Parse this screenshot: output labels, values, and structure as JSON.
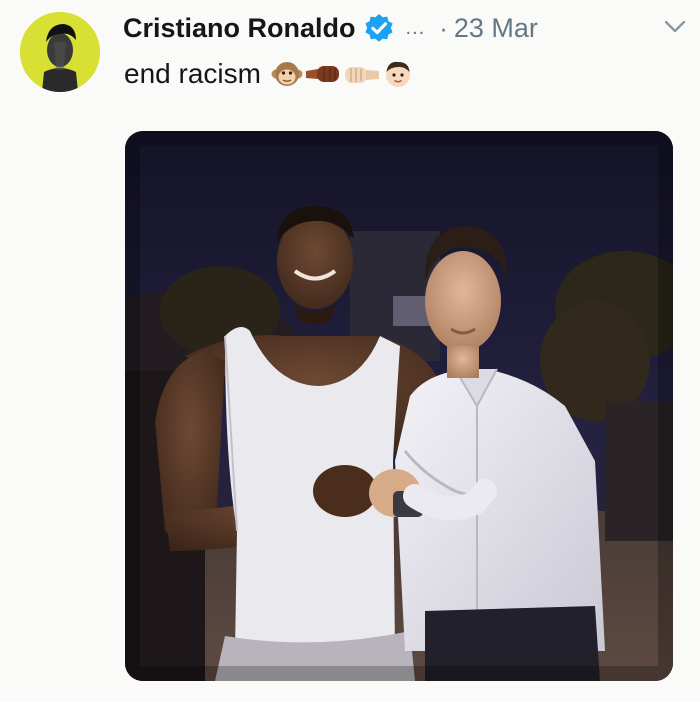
{
  "tweet": {
    "author_name": "Cristiano Ronaldo",
    "verified": true,
    "ellipsis": "...",
    "separator": "·",
    "date": "23 Mar",
    "text": "end racism",
    "emojis": [
      "monkey-face-icon",
      "fist-bump-dark-skin-icon",
      "fist-bump-light-skin-icon",
      "boy-face-icon"
    ],
    "media": {
      "type": "photo"
    }
  },
  "colors": {
    "verified_blue": "#1da1f2",
    "secondary_text": "#657786",
    "avatar_bg": "#d8e034"
  }
}
